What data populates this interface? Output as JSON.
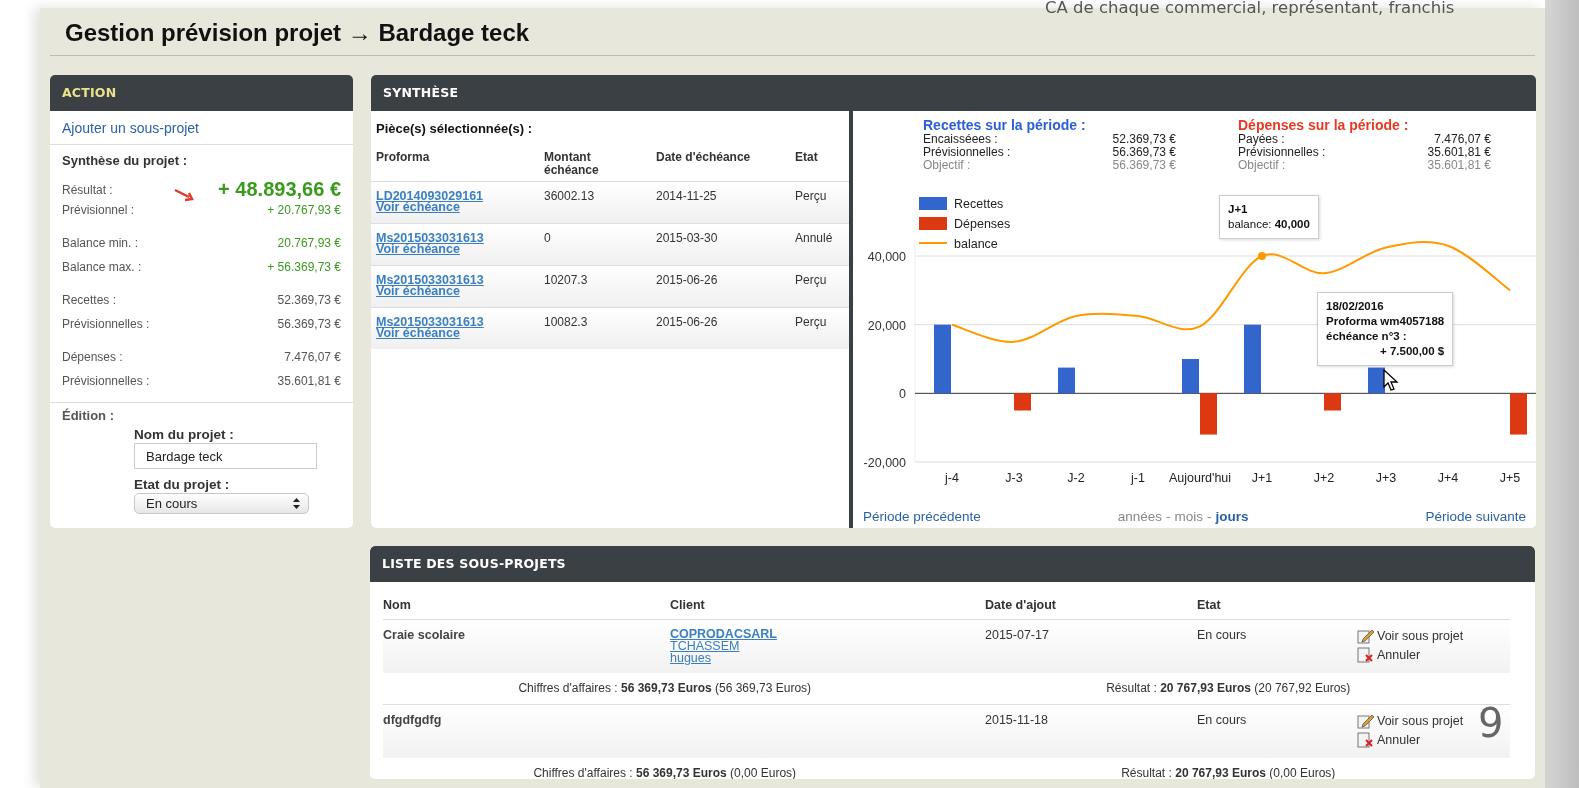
{
  "slide": {
    "caption": "CA de chaque commercial, représentant, franchis",
    "page_number": "9"
  },
  "page_title": "Gestion prévision projet → Bardage teck",
  "action": {
    "title": "ACTION",
    "link": "Ajouter un sous-projet",
    "summary_label": "Synthèse du projet :",
    "groups": [
      {
        "rows": [
          {
            "label": "Résultat :",
            "value": "+ 48.893,66 €",
            "kind": "headline"
          },
          {
            "label": "Prévisionnel :",
            "value": "+ 20.767,93 €",
            "kind": "positive"
          }
        ]
      },
      {
        "rows": [
          {
            "label": "Balance min. :",
            "value": "20.767,93 €",
            "kind": "positive"
          },
          {
            "label": "Balance max. :",
            "value": "+ 56.369,73 €",
            "kind": "positive"
          }
        ]
      },
      {
        "rows": [
          {
            "label": "Recettes :",
            "value": "52.369,73 €",
            "kind": "plain"
          },
          {
            "label": "Prévisionnelles :",
            "value": "56.369,73 €",
            "kind": "plain"
          }
        ]
      },
      {
        "rows": [
          {
            "label": "Dépenses :",
            "value": "7.476,07 €",
            "kind": "plain"
          },
          {
            "label": "Prévisionnelles :",
            "value": "35.601,81 €",
            "kind": "plain"
          }
        ]
      }
    ],
    "edition": {
      "label": "Édition :",
      "name_label": "Nom du projet :",
      "name_value": "Bardage teck",
      "state_label": "Etat du projet :",
      "state_value": "En cours"
    }
  },
  "synthese": {
    "title": "SYNTHÈSE",
    "pieces_label": "Pièce(s) sélectionnée(s) :",
    "columns": [
      "Proforma",
      "Montant échéance",
      "Date d'échéance",
      "Etat"
    ],
    "rows": [
      {
        "proforma": "LD2014093029161",
        "link": "Voir échéance",
        "amount": "36002.13",
        "date": "2014-11-25",
        "state": "Perçu"
      },
      {
        "proforma": "Ms2015033031613",
        "link": "Voir échéance",
        "amount": "0",
        "date": "2015-03-30",
        "state": "Annulé"
      },
      {
        "proforma": "Ms2015033031613",
        "link": "Voir échéance",
        "amount": "10207.3",
        "date": "2015-06-26",
        "state": "Perçu"
      },
      {
        "proforma": "Ms2015033031613",
        "link": "Voir échéance",
        "amount": "10082.3",
        "date": "2015-06-26",
        "state": "Perçu"
      }
    ],
    "summaries": [
      {
        "kind": "income",
        "title": "Recettes sur la période :",
        "rows": [
          {
            "label": "Encaisséees :",
            "value": "52.369,73 €",
            "kind": "main"
          },
          {
            "label": "Prévisionnelles :",
            "value": "56.369,73 €",
            "kind": "main"
          },
          {
            "label": "Objectif :",
            "value": "56.369,73 €",
            "kind": "target"
          }
        ]
      },
      {
        "kind": "expense",
        "title": "Dépenses sur la période :",
        "rows": [
          {
            "label": "Payées :",
            "value": "7.476,07 €",
            "kind": "main"
          },
          {
            "label": "Prévisionnelles :",
            "value": "35.601,81 €",
            "kind": "main"
          },
          {
            "label": "Objectif :",
            "value": "35.601,81 €",
            "kind": "target"
          }
        ]
      }
    ],
    "chart_data": {
      "type": "bar",
      "categories": [
        "j-4",
        "J-3",
        "J-2",
        "j-1",
        "Aujourd'hui",
        "J+1",
        "J+2",
        "J+3",
        "J+4",
        "J+5"
      ],
      "series": [
        {
          "name": "Recettes",
          "color": "#3366cc",
          "type": "bar",
          "values": [
            20000,
            null,
            7500,
            null,
            10000,
            20000,
            null,
            7500,
            null,
            null
          ]
        },
        {
          "name": "Dépenses",
          "color": "#dc3912",
          "type": "bar",
          "values": [
            null,
            -5000,
            null,
            null,
            -12000,
            null,
            -5000,
            null,
            null,
            -12000
          ]
        },
        {
          "name": "balance",
          "color": "#ff9900",
          "type": "line",
          "values": [
            20000,
            15000,
            22500,
            22500,
            19500,
            40000,
            35000,
            42500,
            43000,
            30000
          ]
        }
      ],
      "ylim": [
        -20000,
        45000
      ],
      "legend": "upper left",
      "yticks": [
        {
          "value": -20000,
          "label": "-20,000"
        },
        {
          "value": 0,
          "label": "0"
        },
        {
          "value": 20000,
          "label": "20,000"
        },
        {
          "value": 40000,
          "label": "40,000"
        }
      ],
      "annotations": [
        {
          "x": "J+1",
          "y": 40000,
          "text": "**J+1**\nbalance: **40,000**"
        },
        {
          "x": "J+3",
          "y": 7500,
          "text": "**18/02/2016**\n**Proforma wm4057188**\n**échéance n°3 :**\n**+ 7.500,00 $**"
        }
      ]
    },
    "pager": {
      "previous": "Période précédente",
      "separator": "-",
      "options": [
        {
          "label": "années",
          "selected": false
        },
        {
          "label": "mois",
          "selected": false
        },
        {
          "label": "jours",
          "selected": true
        }
      ],
      "next": "Période suivante"
    }
  },
  "subprojects": {
    "title": "LISTE DES SOUS-PROJETS",
    "columns": [
      "Nom",
      "Client",
      "Date d'ajout",
      "Etat"
    ],
    "rows": [
      {
        "name": "Craie scolaire",
        "client": [
          "COPRODACSARL",
          "TCHASSEM",
          "hugues"
        ],
        "date": "2015-07-17",
        "state": "En cours",
        "actions": [
          {
            "kind": "view",
            "label": "Voir sous projet"
          },
          {
            "kind": "cancel",
            "label": "Annuler"
          }
        ],
        "ca": "Chiffres d'affaires : **56 369,73 Euros** (56 369,73 Euros)",
        "result": "Résultat : **20 767,93 Euros** (20 767,92 Euros)"
      },
      {
        "name": "dfgdfgdfg",
        "date": "2015-11-18",
        "state": "En cours",
        "actions": [
          {
            "kind": "view",
            "label": "Voir sous projet"
          },
          {
            "kind": "cancel",
            "label": "Annuler"
          }
        ],
        "ca": "Chiffres d'affaires : **56 369,73 Euros** (0,00 Euros)",
        "result": "Résultat : **20 767,93 Euros** (0,00 Euros)"
      }
    ]
  }
}
